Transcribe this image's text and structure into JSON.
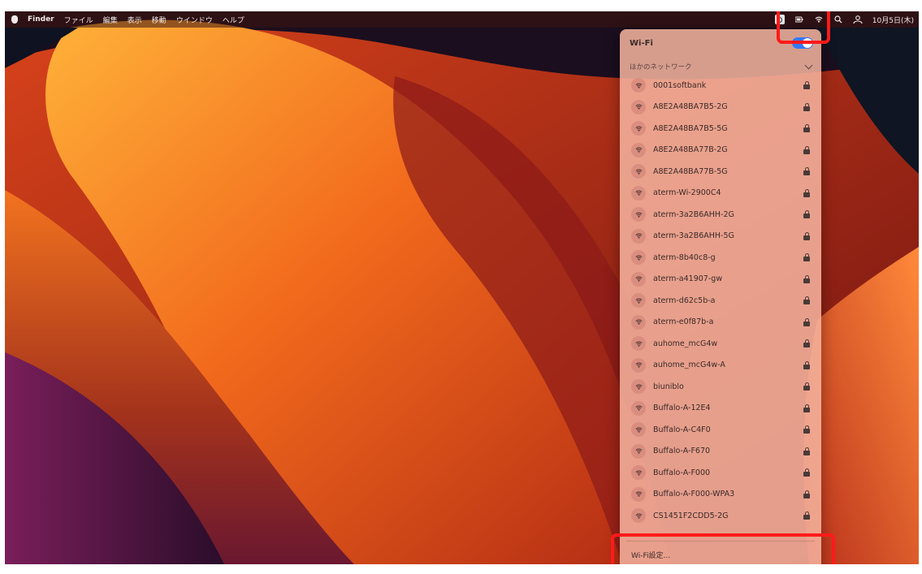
{
  "menubar": {
    "app_name": "Finder",
    "menus": [
      "ファイル",
      "編集",
      "表示",
      "移動",
      "ウインドウ",
      "ヘルプ"
    ],
    "clock": "10月5日(木)"
  },
  "wifi_panel": {
    "title": "Wi-Fi",
    "toggle_on": true,
    "section_label": "ほかのネットワーク",
    "networks": [
      {
        "name": "0001softbank",
        "locked": true
      },
      {
        "name": "A8E2A48BA7B5-2G",
        "locked": true
      },
      {
        "name": "A8E2A48BA7B5-5G",
        "locked": true
      },
      {
        "name": "A8E2A48BA77B-2G",
        "locked": true
      },
      {
        "name": "A8E2A48BA77B-5G",
        "locked": true
      },
      {
        "name": "aterm-Wi-2900C4",
        "locked": true
      },
      {
        "name": "aterm-3a2B6AHH-2G",
        "locked": true
      },
      {
        "name": "aterm-3a2B6AHH-5G",
        "locked": true
      },
      {
        "name": "aterm-8b40c8-g",
        "locked": true
      },
      {
        "name": "aterm-a41907-gw",
        "locked": true
      },
      {
        "name": "aterm-d62c5b-a",
        "locked": true
      },
      {
        "name": "aterm-e0f87b-a",
        "locked": true
      },
      {
        "name": "auhome_mcG4w",
        "locked": true
      },
      {
        "name": "auhome_mcG4w-A",
        "locked": true
      },
      {
        "name": "biuniblo",
        "locked": true
      },
      {
        "name": "Buffalo-A-12E4",
        "locked": true
      },
      {
        "name": "Buffalo-A-C4F0",
        "locked": true
      },
      {
        "name": "Buffalo-A-F670",
        "locked": true
      },
      {
        "name": "Buffalo-A-F000",
        "locked": true
      },
      {
        "name": "Buffalo-A-F000-WPA3",
        "locked": true
      },
      {
        "name": "CS1451F2CDD5-2G",
        "locked": true
      }
    ],
    "settings_label": "Wi-Fi設定..."
  },
  "colors": {
    "highlight": "#ff1a1a",
    "toggle": "#3478f6"
  }
}
